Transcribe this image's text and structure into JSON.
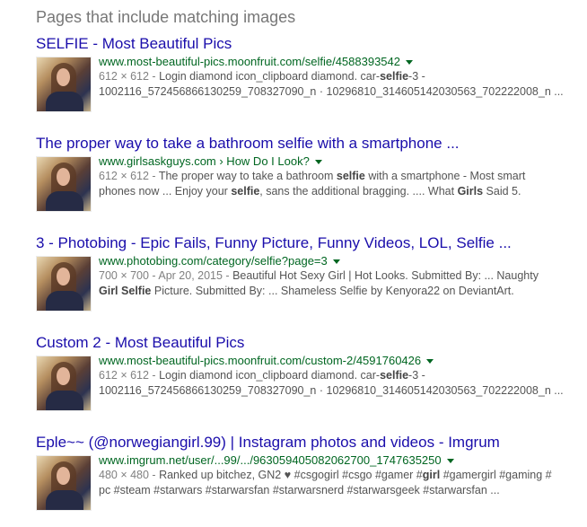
{
  "heading": "Pages that include matching images",
  "results": [
    {
      "title_bold": "SELFIE",
      "title_rest": " - Most Beautiful Pics",
      "url": "www.most-beautiful-pics.moonfruit.com/selfie/4588393542",
      "meta": "612 × 612 -",
      "line1": [
        " Login diamond icon_clipboard diamond. car-",
        "selfie",
        "-3 -"
      ],
      "line2": "1002116_572456866130259_708327090_n · 10296810_314605142030563_702222008_n ..."
    },
    {
      "title": "The proper way to take a bathroom selfie with a smartphone ...",
      "url": "www.girlsaskguys.com › How Do I Look?",
      "meta": "612 × 612 -",
      "line1": [
        " The proper way to take a bathroom ",
        "selfie",
        " with a smartphone - Most smart"
      ],
      "line2": [
        "phones now ... Enjoy your ",
        "selfie",
        ", sans the additional bragging. .... What ",
        "Girls",
        " Said 5."
      ]
    },
    {
      "title": "3 - Photobing - Epic Fails, Funny Picture, Funny Videos, LOL, Selfie ...",
      "url": "www.photobing.com/category/selfie?page=3",
      "meta": "700 × 700 - Apr 20, 2015 -",
      "line1": " Beautiful Hot Sexy Girl | Hot Looks. Submitted By: ... Naughty",
      "line2": [
        "Girl",
        " ",
        "Selfie",
        " Picture. Submitted By: ... Shameless Selfie by Kenyora22 on DeviantArt."
      ]
    },
    {
      "title": "Custom 2 - Most Beautiful Pics",
      "url": "www.most-beautiful-pics.moonfruit.com/custom-2/4591760426",
      "meta": "612 × 612 -",
      "line1": [
        " Login diamond icon_clipboard diamond. car-",
        "selfie",
        "-3 -"
      ],
      "line2": "1002116_572456866130259_708327090_n · 10296810_314605142030563_702222008_n ..."
    },
    {
      "title": "Eple~~ (@norwegiangirl.99) | Instagram photos and videos - Imgrum",
      "url": "www.imgrum.net/user/...99/.../963059405082062700_1747635250",
      "meta": "480 × 480 -",
      "line1": [
        " Ranked up bitchez, GN2 ♥ #csgogirl #csgo #gamer #",
        "girl",
        " #gamergirl #gaming #"
      ],
      "line2": "pc #steam #starwars #starwarsfan #starwarsnerd #starwarsgeek #starwarsfan ..."
    }
  ]
}
